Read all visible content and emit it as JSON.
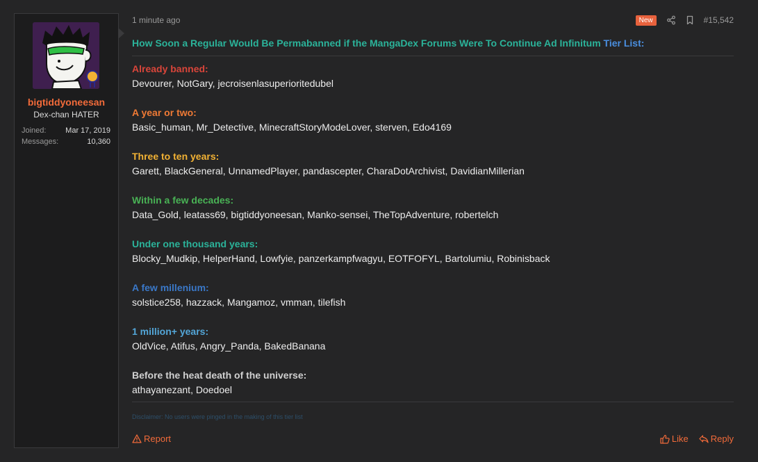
{
  "user": {
    "name": "bigtiddyoneesan",
    "title": "Dex-chan HATER",
    "stats": [
      {
        "label": "Joined:",
        "value": "Mar 17, 2019"
      },
      {
        "label": "Messages:",
        "value": "10,360"
      }
    ]
  },
  "post": {
    "time": "1 minute ago",
    "badge": "New",
    "number": "#15,542",
    "title_main": "How Soon a Regular Would Be Permabanned if the MangaDex Forums Were To Continue Ad Infinitum",
    "title_tail": "Tier List:",
    "tiers": [
      {
        "heading": "Already banned:",
        "color": "#d9453a",
        "names": "Devourer, NotGary, jecroisenlasuperioritedubel"
      },
      {
        "heading": "A year or two:",
        "color": "#ef7a35",
        "names": "Basic_human, Mr_Detective, MinecraftStoryModeLover, sterven, Edo4169"
      },
      {
        "heading": "Three to ten years:",
        "color": "#f2b234",
        "names": "Garett, BlackGeneral, UnnamedPlayer, pandascepter, CharaDotArchivist, DavidianMillerian"
      },
      {
        "heading": "Within a few decades:",
        "color": "#49b255",
        "names": "Data_Gold, leatass69, bigtiddyoneesan, Manko-sensei, TheTopAdventure, robertelch"
      },
      {
        "heading": "Under one thousand years:",
        "color": "#2bb39a",
        "names": "Blocky_Mudkip, HelperHand, Lowfyie, panzerkampfwagyu, EOTFOFYL, Bartolumiu, Robinisback"
      },
      {
        "heading": "A few millenium:",
        "color": "#3a78c8",
        "names": "solstice258, hazzack, Mangamoz, vmman, tilefish"
      },
      {
        "heading": "1 million+ years:",
        "color": "#53a6d8",
        "names": "OldVice, Atifus, Angry_Panda, BakedBanana"
      },
      {
        "heading": "Before the heat death of the universe:",
        "color": "#d0d0d0",
        "names": "athayanezant, Doedoel"
      }
    ],
    "disclaimer": "Disclaimer: No users were pinged in the making of this tier list"
  },
  "actions": {
    "report": "Report",
    "like": "Like",
    "reply": "Reply"
  },
  "colors": {
    "accent": "#f26b3a",
    "background": "#252526",
    "panel": "#1c1c1d"
  }
}
